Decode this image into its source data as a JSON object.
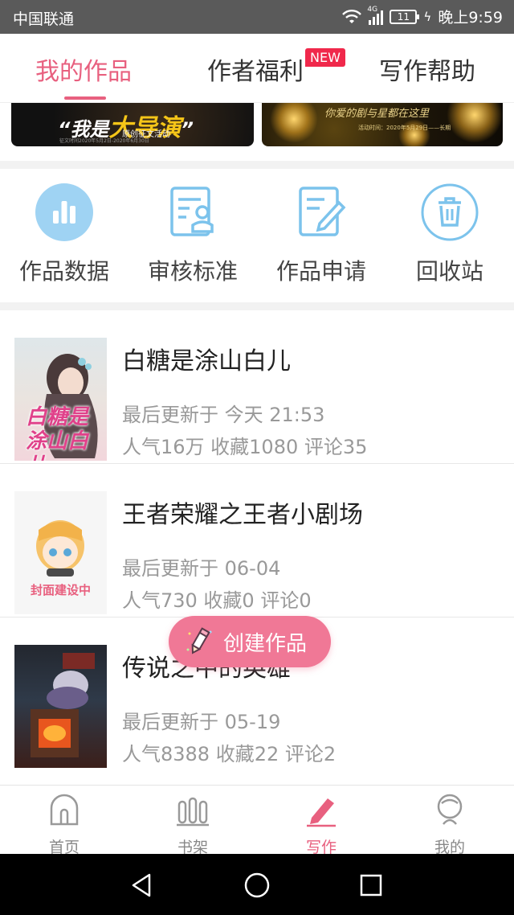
{
  "status_bar": {
    "carrier": "中国联通",
    "network": "4G",
    "battery": "11",
    "time": "晚上9:59"
  },
  "top_tabs": {
    "items": [
      {
        "label": "我的作品",
        "active": true
      },
      {
        "label": "作者福利",
        "badge": "NEW"
      },
      {
        "label": "写作帮助"
      }
    ]
  },
  "banners": [
    {
      "headline_pre": "“我是",
      "headline_big": "大导演",
      "headline_post": "”",
      "subtitle": "原创征文活动",
      "date": "征文时间2020年5月2日-2020年6月30日"
    },
    {
      "headline": "你爱的剧与星都在这里",
      "date": "活动时间：2020年5月29日——长期"
    }
  ],
  "tools": [
    {
      "label": "作品数据",
      "icon": "chart-icon"
    },
    {
      "label": "审核标准",
      "icon": "review-standard-icon"
    },
    {
      "label": "作品申请",
      "icon": "apply-icon"
    },
    {
      "label": "回收站",
      "icon": "trash-icon"
    }
  ],
  "works": [
    {
      "title": "白糖是涂山白儿",
      "updated": "最后更新于 今天 21:53",
      "stats": "人气16万 收藏1080 评论35",
      "cover_text": "白糖是涂山白儿"
    },
    {
      "title": "王者荣耀之王者小剧场",
      "updated": "最后更新于 06-04",
      "stats": "人气730 收藏0 评论0",
      "cover_text": "封面建设中"
    },
    {
      "title": "传说之中的英雄",
      "updated": "最后更新于 05-19",
      "stats": "人气8388 收藏22 评论2"
    }
  ],
  "fab": {
    "label": "创建作品"
  },
  "bottom_nav": [
    {
      "label": "首页",
      "icon": "home-icon"
    },
    {
      "label": "书架",
      "icon": "bookshelf-icon"
    },
    {
      "label": "写作",
      "icon": "write-icon",
      "active": true
    },
    {
      "label": "我的",
      "icon": "profile-icon"
    }
  ],
  "colors": {
    "accent": "#e8607f",
    "fab": "#f07896",
    "icon_blue": "#7cc3ec"
  }
}
